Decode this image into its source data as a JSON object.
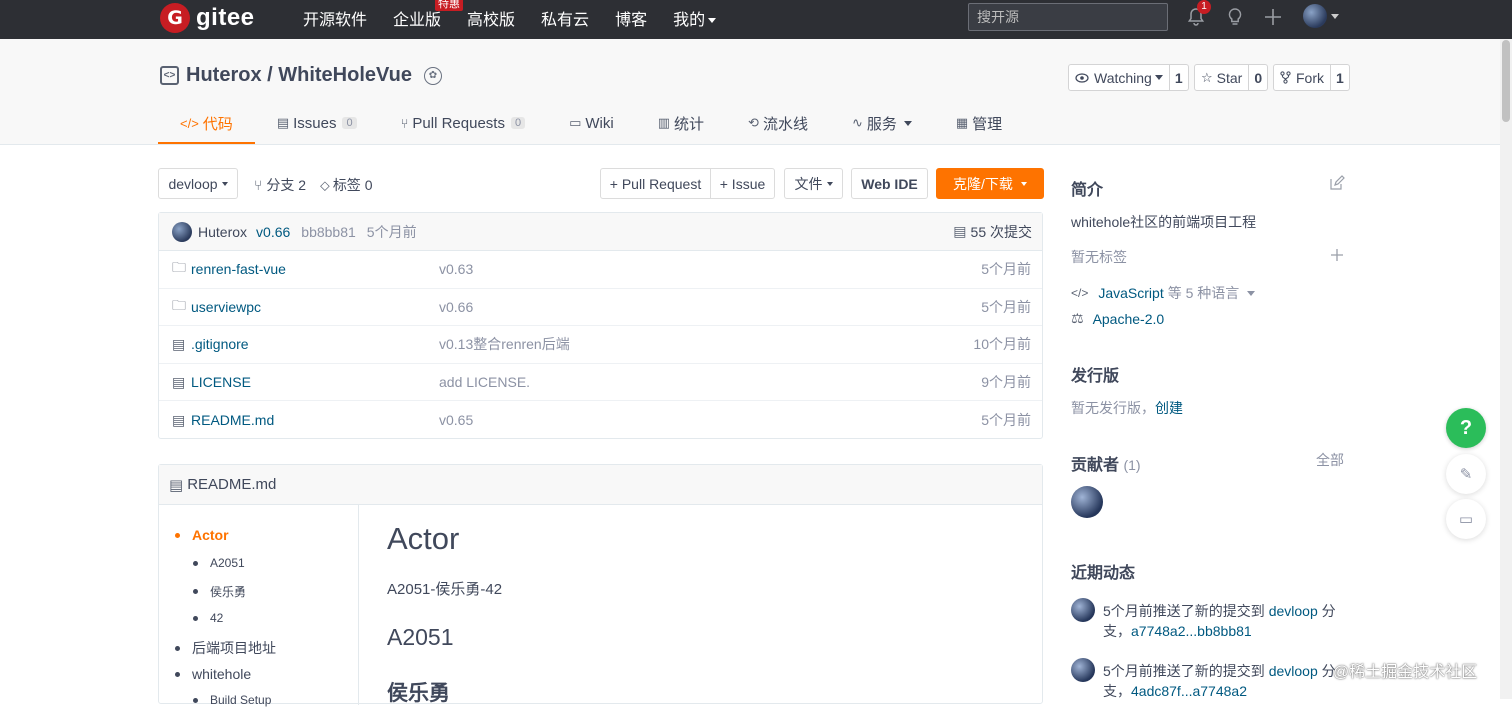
{
  "nav": {
    "logo_text": "gitee",
    "logo_letter": "G",
    "items": [
      "开源软件",
      "企业版",
      "高校版",
      "私有云",
      "博客",
      "我的"
    ],
    "hot_badge": "特惠",
    "search_placeholder": "搜开源",
    "notification_count": "1"
  },
  "repo": {
    "title": "Huterox / WhiteHoleVue",
    "watch_label": "Watching",
    "watch_count": "1",
    "star_label": "Star",
    "star_count": "0",
    "fork_label": "Fork",
    "fork_count": "1"
  },
  "tabs": [
    {
      "label": "代码",
      "icon": "code-icon"
    },
    {
      "label": "Issues",
      "count": "0",
      "icon": "issues-icon"
    },
    {
      "label": "Pull Requests",
      "count": "0",
      "icon": "pull-request-icon"
    },
    {
      "label": "Wiki",
      "icon": "wiki-icon"
    },
    {
      "label": "统计",
      "icon": "stats-icon"
    },
    {
      "label": "流水线",
      "icon": "pipeline-icon"
    },
    {
      "label": "服务",
      "icon": "service-icon"
    },
    {
      "label": "管理",
      "icon": "manage-icon"
    }
  ],
  "toolbar": {
    "branch": "devloop",
    "branches": "分支 2",
    "tags": "标签 0",
    "pull_request": "+ Pull Request",
    "issue": "+ Issue",
    "file": "文件",
    "web_ide": "Web IDE",
    "clone": "克隆/下载"
  },
  "commit": {
    "author": "Huterox",
    "version": "v0.66",
    "hash": "bb8bb81",
    "time": "5个月前",
    "count": "55 次提交"
  },
  "files": [
    {
      "name": "renren-fast-vue",
      "type": "folder",
      "message": "v0.63",
      "time": "5个月前"
    },
    {
      "name": "userviewpc",
      "type": "folder",
      "message": "v0.66",
      "time": "5个月前"
    },
    {
      "name": ".gitignore",
      "type": "file",
      "message": "v0.13整合renren后端",
      "time": "10个月前"
    },
    {
      "name": "LICENSE",
      "type": "file",
      "message": "add LICENSE.",
      "time": "9个月前"
    },
    {
      "name": "README.md",
      "type": "file",
      "message": "v0.65",
      "time": "5个月前"
    }
  ],
  "readme": {
    "title": "README.md",
    "toc": [
      "Actor",
      "A2051",
      "侯乐勇",
      "42",
      "后端项目地址",
      "whitehole",
      "Build Setup"
    ],
    "h1": "Actor",
    "p1": "A2051-侯乐勇-42",
    "h2": "A2051",
    "h3": "侯乐勇"
  },
  "sidebar": {
    "intro_title": "简介",
    "intro_text": "whitehole社区的前端项目工程",
    "no_tags": "暂无标签",
    "language": "JavaScript",
    "language_suffix": "等 5 种语言",
    "license": "Apache-2.0",
    "release_title": "发行版",
    "no_release": "暂无发行版，",
    "create": "创建",
    "contributors_title": "贡献者",
    "contributors_count": "(1)",
    "all": "全部",
    "activity_title": "近期动态",
    "activities": [
      {
        "prefix": "5个月前推送了新的提交到",
        "branch": "devloop",
        "suffix": "分",
        "line2_prefix": "支，",
        "range": "a7748a2...bb8bb81"
      },
      {
        "prefix": "5个月前推送了新的提交到",
        "branch": "devloop",
        "suffix": "分",
        "line2_prefix": "支，",
        "range": "4adc87f...a7748a2"
      }
    ]
  },
  "floating": {
    "help": "?"
  },
  "watermark": "@稀土掘金技术社区",
  "colors": {
    "accent": "#fe7300",
    "nav_bg": "#2d2f34",
    "link": "#005980",
    "brand_red": "#c71d23",
    "help_green": "#2bbd5a"
  }
}
